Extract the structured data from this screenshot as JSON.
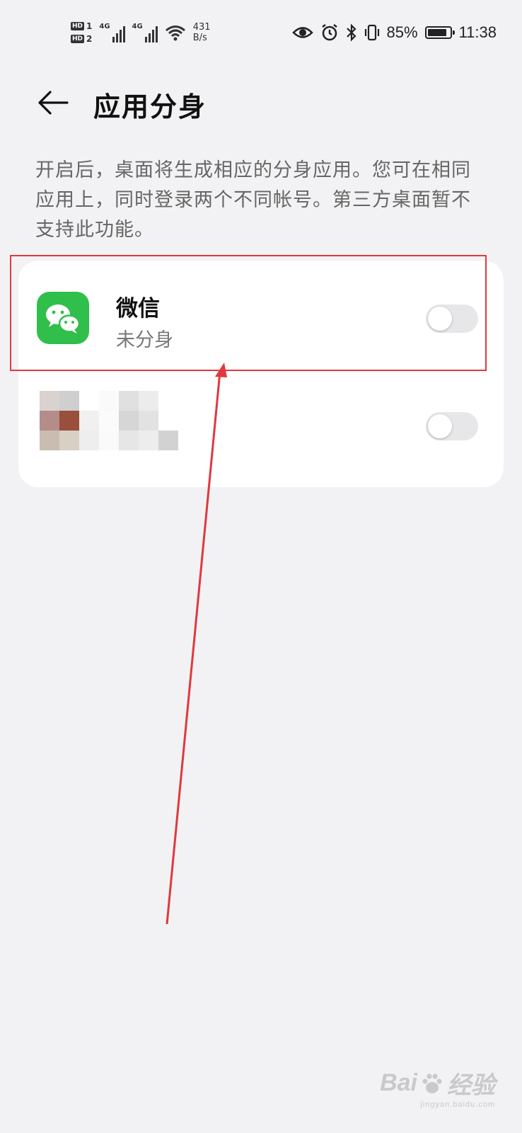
{
  "status_bar": {
    "sim1": "HD",
    "sim1_index": "1",
    "sim2": "HD",
    "sim2_index": "2",
    "network1": "4G",
    "network2": "4G",
    "speed_value": "431",
    "speed_unit": "B/s",
    "battery_percent": "85%",
    "battery_level": 85,
    "time": "11:38",
    "icons": [
      "eye-icon",
      "alarm-icon",
      "bluetooth-icon",
      "vibrate-icon",
      "battery-icon"
    ]
  },
  "header": {
    "back_icon": "arrow-left-icon",
    "title": "应用分身"
  },
  "description": "开启后，桌面将生成相应的分身应用。您可在相同应用上，同时登录两个不同帐号。第三方桌面暂不支持此功能。",
  "apps": [
    {
      "name": "微信",
      "status": "未分身",
      "icon": "wechat-icon",
      "icon_color": "#2fbf4a",
      "enabled": false
    },
    {
      "name": "",
      "status": "",
      "icon": "pixelated-app-icon",
      "enabled": false
    }
  ],
  "annotation": {
    "color": "#e0383e"
  },
  "watermark": {
    "brand": "Bai",
    "brand_suffix": "经验",
    "url": "jingyan.baidu.com"
  }
}
